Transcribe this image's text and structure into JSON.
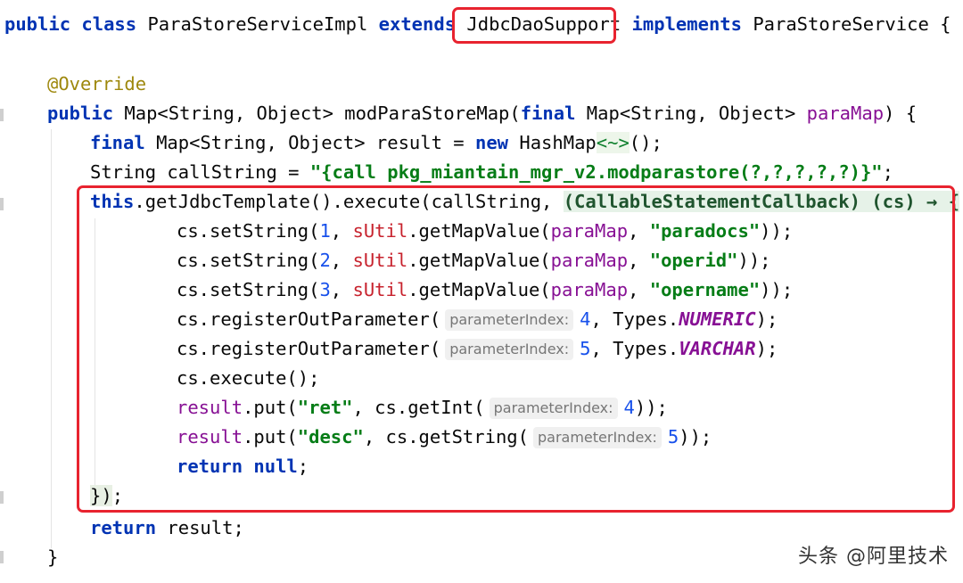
{
  "editor": {
    "class_decl": {
      "kw_public": "public",
      "kw_class": "class",
      "class_name": "ParaStoreServiceImpl",
      "kw_extends": "extends",
      "parent": "JdbcDaoSupport",
      "kw_implements": "implements",
      "iface": "ParaStoreService",
      "brace": "{"
    },
    "override": "@Override",
    "method_sig": {
      "kw_public": "public",
      "ret_type": "Map<String, Object>",
      "name": "modParaStoreMap(",
      "kw_final": "final",
      "param_type": "Map<String, Object>",
      "param": "paraMap",
      "tail": ") {"
    },
    "line_result": {
      "kw_final": "final",
      "decl": "Map<String, Object> result = ",
      "kw_new": "new",
      "ctor": "HashMap",
      "diamond": "<~>",
      "tail": "();"
    },
    "line_call": {
      "decl": "String callString = ",
      "value": "\"{call pkg_miantain_mgr_v2.modparastore(?,?,?,?,?)}\"",
      "tail": ";"
    },
    "line_execute": {
      "kw_this": "this",
      "call": ".getJdbcTemplate().execute(callString, ",
      "lambda": "(CallableStatementCallback) (cs) → {"
    },
    "set_strings": [
      {
        "pre": "cs.setString(",
        "num": "1",
        "sep": ", ",
        "util": "sUtil",
        "mid": ".getMapValue(",
        "param": "paraMap",
        "comma": ", ",
        "key": "\"paradocs\"",
        "tail": "));"
      },
      {
        "pre": "cs.setString(",
        "num": "2",
        "sep": ", ",
        "util": "sUtil",
        "mid": ".getMapValue(",
        "param": "paraMap",
        "comma": ", ",
        "key": "\"operid\"",
        "tail": "));"
      },
      {
        "pre": "cs.setString(",
        "num": "3",
        "sep": ", ",
        "util": "sUtil",
        "mid": ".getMapValue(",
        "param": "paraMap",
        "comma": ", ",
        "key": "\"opername\"",
        "tail": "));"
      }
    ],
    "register_out": [
      {
        "pre": "cs.registerOutParameter(",
        "hint": "parameterIndex:",
        "num": "4",
        "mid": ", Types.",
        "field": "NUMERIC",
        "tail": ");"
      },
      {
        "pre": "cs.registerOutParameter(",
        "hint": "parameterIndex:",
        "num": "5",
        "mid": ", Types.",
        "field": "VARCHAR",
        "tail": ");"
      }
    ],
    "cs_execute": "cs.execute();",
    "put_ret": {
      "var": "result",
      "mid": ".put(",
      "key": "\"ret\"",
      "call": ", cs.getInt(",
      "hint": "parameterIndex:",
      "num": "4",
      "tail": "));"
    },
    "put_desc": {
      "var": "result",
      "mid": ".put(",
      "key": "\"desc\"",
      "call": ", cs.getString(",
      "hint": "parameterIndex:",
      "num": "5",
      "tail": "));"
    },
    "return_null": {
      "kw_return": "return",
      "kw_null": "null",
      "tail": ";"
    },
    "close_lambda": {
      "brace": "})",
      "tail": ";"
    },
    "return_result": {
      "kw_return": "return",
      "rest": " result;"
    },
    "close_method": "}"
  },
  "watermark": "头条 @阿里技术",
  "colors": {
    "highlight_box": "#e8232f",
    "keyword": "#0033b3",
    "string": "#067d17",
    "number": "#1750eb"
  }
}
